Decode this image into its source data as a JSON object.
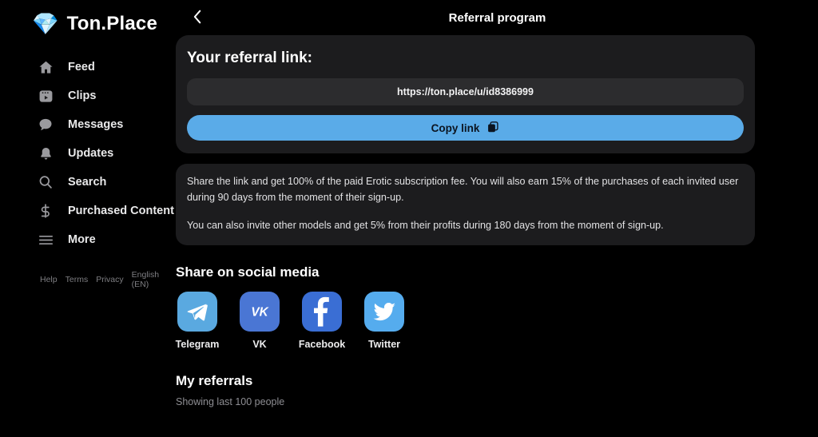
{
  "brand": {
    "name": "Ton.Place",
    "logo_icon": "gem-diamond-icon",
    "logo_glyph": "💎"
  },
  "sidebar": {
    "items": [
      {
        "label": "Feed",
        "icon": "home-icon"
      },
      {
        "label": "Clips",
        "icon": "clips-icon"
      },
      {
        "label": "Messages",
        "icon": "message-bubble-icon"
      },
      {
        "label": "Updates",
        "icon": "bell-icon"
      },
      {
        "label": "Search",
        "icon": "search-icon"
      },
      {
        "label": "Purchased Content",
        "icon": "dollar-icon"
      },
      {
        "label": "More",
        "icon": "hamburger-icon"
      }
    ],
    "footer_links": [
      "Help",
      "Terms",
      "Privacy",
      "English (EN)"
    ]
  },
  "header": {
    "title": "Referral program",
    "back_icon": "chevron-left-icon"
  },
  "referral_card": {
    "title": "Your referral link:",
    "link": "https://ton.place/u/id8386999",
    "copy_label": "Copy link",
    "copy_icon": "copy-icon",
    "button_color": "#5aabe8"
  },
  "info": {
    "paragraphs": [
      "Share the link and get 100% of the paid Erotic subscription fee. You will also earn 15% of the purchases of each invited user during 90 days from the moment of their sign-up.",
      "You can also invite other models and get 5% from their profits during 180 days from the moment of sign-up."
    ]
  },
  "social": {
    "title": "Share on social media",
    "items": [
      {
        "label": "Telegram",
        "icon": "telegram-icon",
        "color": "#5aa9e0"
      },
      {
        "label": "VK",
        "icon": "vk-icon",
        "color": "#4a76d4"
      },
      {
        "label": "Facebook",
        "icon": "facebook-icon",
        "color": "#3a6ed4"
      },
      {
        "label": "Twitter",
        "icon": "twitter-icon",
        "color": "#55acee"
      }
    ]
  },
  "referrals": {
    "title": "My referrals",
    "subtitle": "Showing last 100 people"
  }
}
